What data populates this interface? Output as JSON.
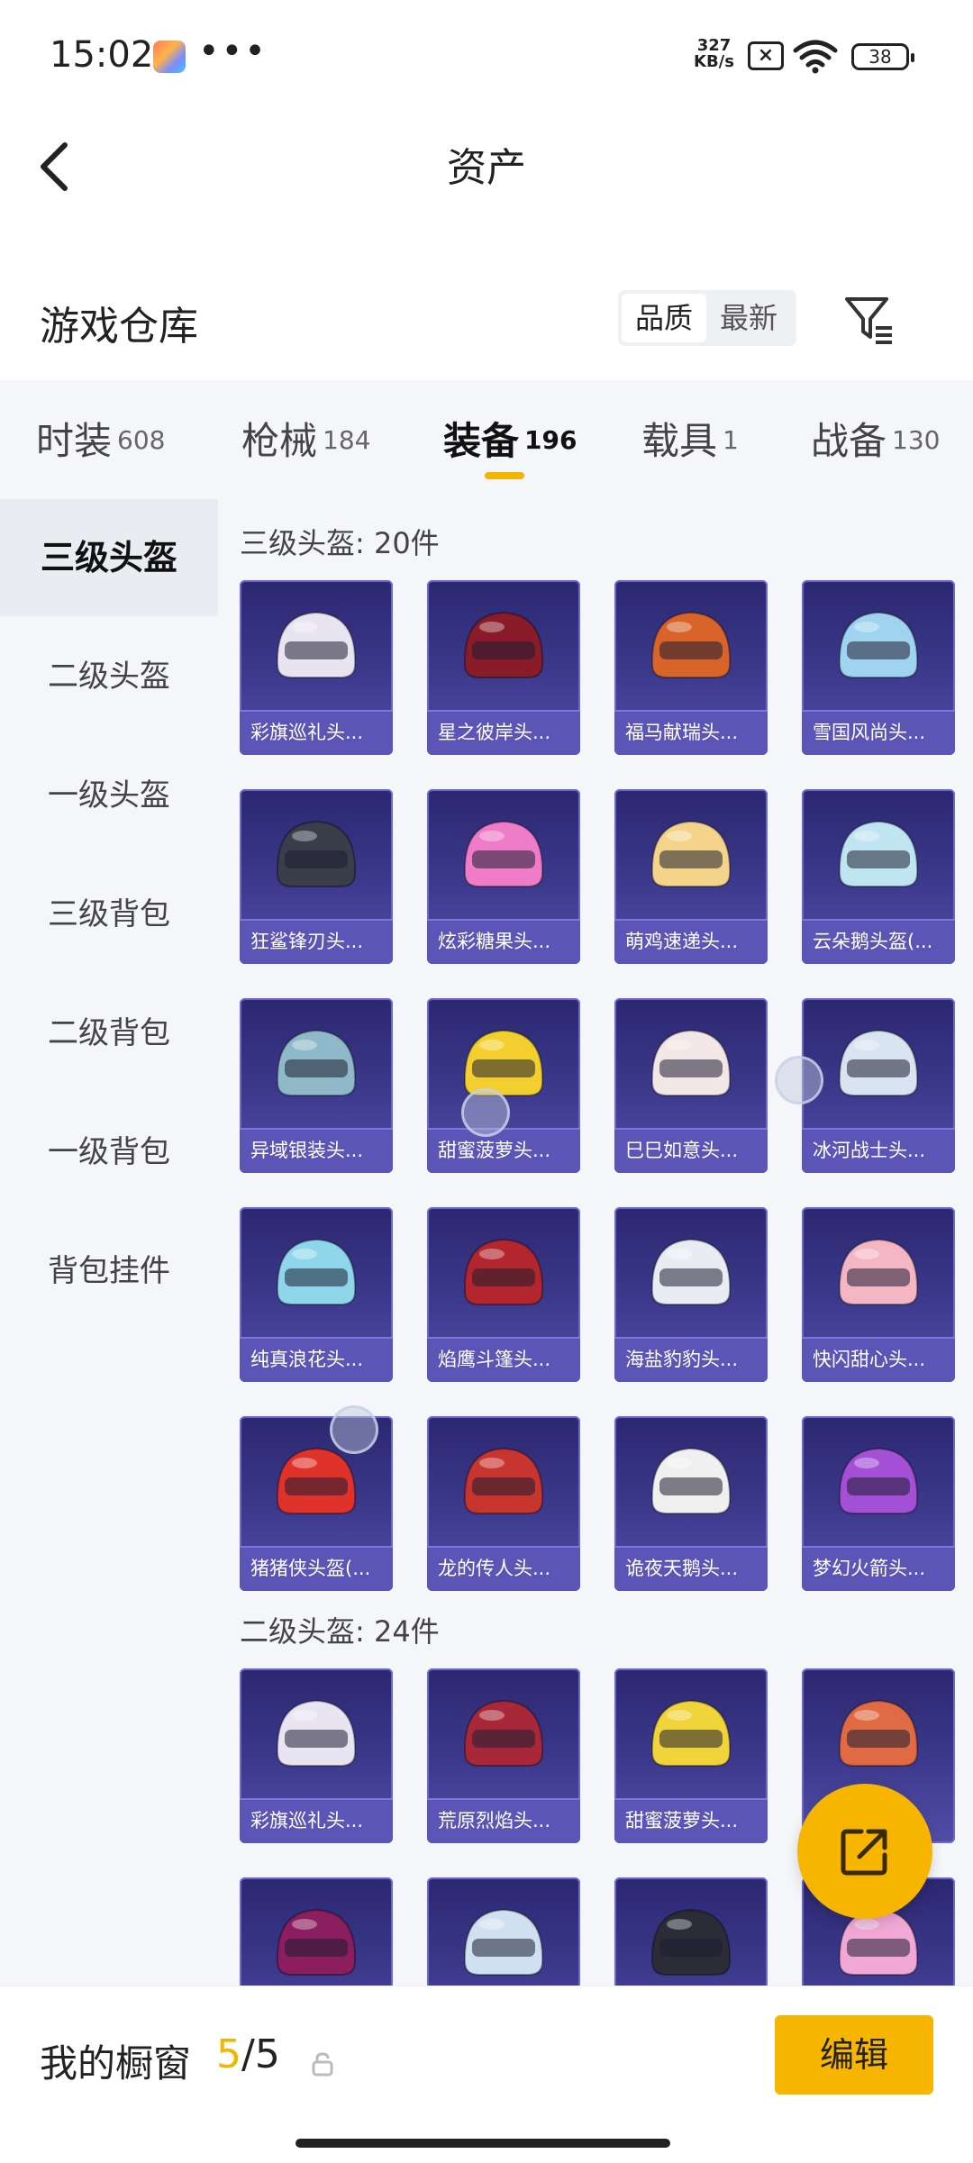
{
  "status_bar": {
    "time": "15:02",
    "dots": "•••",
    "net_speed_value": "327",
    "net_speed_unit": "KB/s",
    "sim_status": "×",
    "battery": "38"
  },
  "nav": {
    "title": "资产"
  },
  "warehouse": {
    "title": "游戏仓库",
    "sort_options": [
      "品质",
      "最新"
    ],
    "active_sort": 0
  },
  "tabs": [
    {
      "label": "时装",
      "count": "608"
    },
    {
      "label": "枪械",
      "count": "184"
    },
    {
      "label": "装备",
      "count": "196"
    },
    {
      "label": "载具",
      "count": "1"
    },
    {
      "label": "战备",
      "count": "130"
    }
  ],
  "active_tab": 2,
  "sidebar": [
    "三级头盔",
    "二级头盔",
    "一级头盔",
    "三级背包",
    "二级背包",
    "一级背包",
    "背包挂件"
  ],
  "active_sidebar": 0,
  "groups": [
    {
      "title": "三级头盔: 20件",
      "items": [
        "彩旗巡礼头...",
        "星之彼岸头...",
        "福马献瑞头...",
        "雪国风尚头...",
        "狂鲨锋刃头...",
        "炫彩糖果头...",
        "萌鸡速递头...",
        "云朵鹅头盔(...",
        "异域银装头...",
        "甜蜜菠萝头...",
        "巳巳如意头...",
        "冰河战士头...",
        "纯真浪花头...",
        "焰鹰斗篷头...",
        "海盐豹豹头...",
        "快闪甜心头...",
        "猪猪侠头盔(...",
        "龙的传人头...",
        "诡夜天鹅头...",
        "梦幻火箭头..."
      ]
    },
    {
      "title": "二级头盔: 24件",
      "items": [
        "彩旗巡礼头...",
        "荒原烈焰头...",
        "甜蜜菠萝头...",
        "",
        "",
        "",
        "",
        ""
      ]
    }
  ],
  "item_colors": [
    "#e8e4f2",
    "#8a1c2a",
    "#d9642a",
    "#9fd3f0",
    "#3a3d4a",
    "#ef7cc8",
    "#f3d48a",
    "#bfe4f2",
    "#8fb8c8",
    "#f2cf2e",
    "#f3e6e6",
    "#d8e4f0",
    "#8fd6ea",
    "#b3262e",
    "#e9edf3",
    "#f4b6c3",
    "#e0322a",
    "#c8342e",
    "#f0f0f0",
    "#a34fd6",
    "#e8e4f2",
    "#a8283a",
    "#f0d43a",
    "#e06a44",
    "#8a1e5e",
    "#cfe0f0",
    "#2c2c38",
    "#f2a8d6"
  ],
  "bottom_bar": {
    "label": "我的橱窗",
    "current": "5",
    "separator": "/",
    "total": "5",
    "edit": "编辑"
  }
}
